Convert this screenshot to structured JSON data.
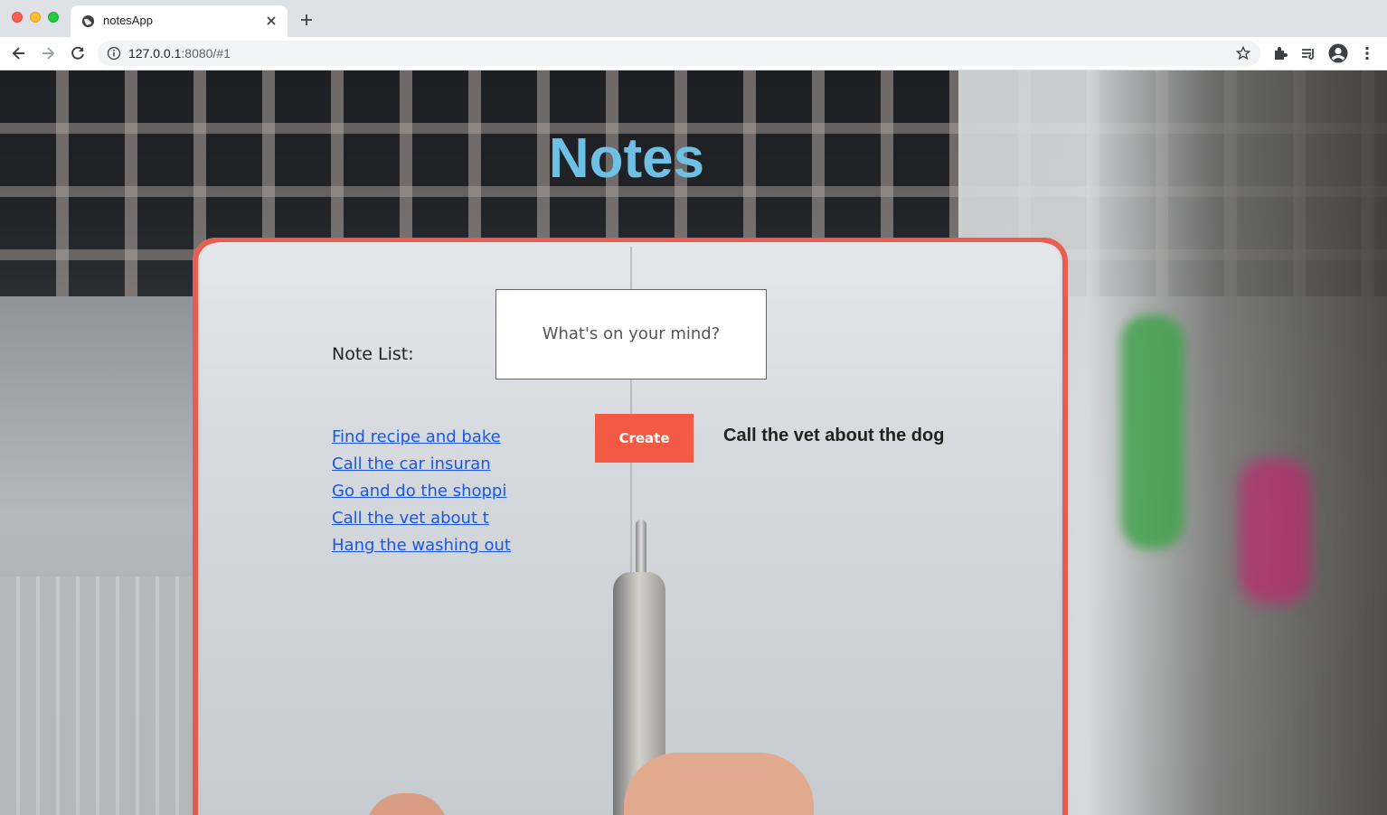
{
  "browser": {
    "tab_title": "notesApp",
    "url_host": "127.0.0.1",
    "url_rest": ":8080/#1"
  },
  "app": {
    "title": "Notes",
    "note_list_label": "Note List:",
    "input_placeholder": "What's on your mind?",
    "create_label": "Create",
    "notes": [
      "Find recipe and bake",
      "Call the car insuran",
      "Go and do the shoppi",
      "Call the vet about t",
      "Hang the washing out"
    ],
    "selected_note": "Call the vet about the dog"
  },
  "colors": {
    "title": "#6ec1e4",
    "link": "#1a56e8",
    "create_button": "#f25a45"
  }
}
